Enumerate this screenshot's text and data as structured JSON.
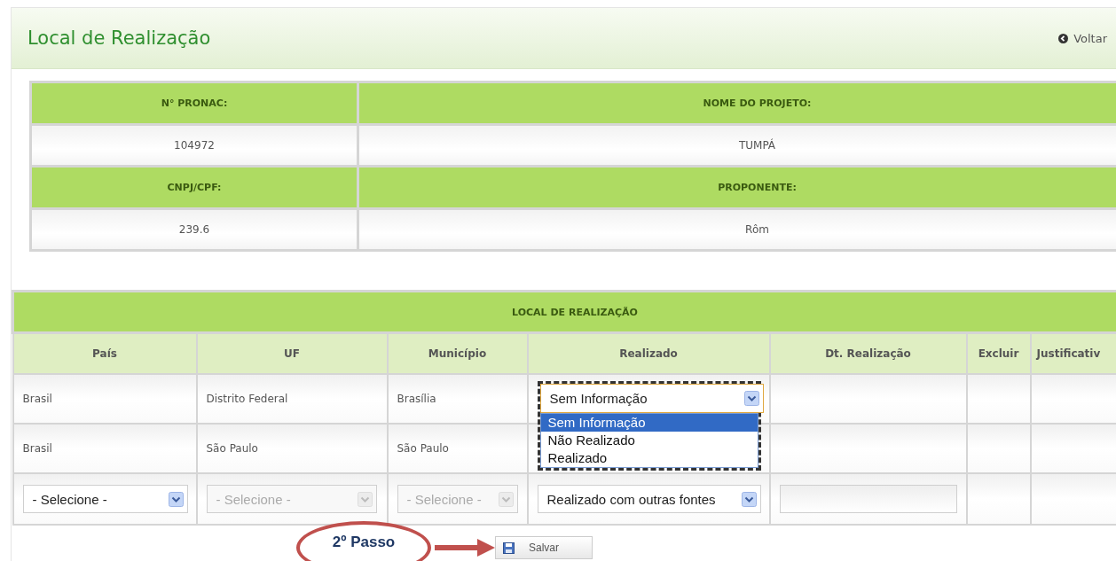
{
  "page": {
    "title": "Local de Realização",
    "back_link": "Voltar"
  },
  "project_info": [
    {
      "cells": [
        {
          "label": "N° PRONAC:",
          "value": "104972"
        },
        {
          "label": "NOME DO PROJETO:",
          "value": "TUMPÁ"
        }
      ]
    },
    {
      "cells": [
        {
          "label": "CNPJ/CPF:",
          "value": "239.6"
        },
        {
          "label": "PROPONENTE:",
          "value": "Rôm"
        }
      ]
    }
  ],
  "locations": {
    "title": "LOCAL DE REALIZAÇÃO",
    "columns": [
      "País",
      "UF",
      "Município",
      "Realizado",
      "Dt. Realização",
      "Excluir",
      "Justificativ"
    ],
    "rows": [
      {
        "pais": "Brasil",
        "uf": "Distrito Federal",
        "municipio": "Brasília",
        "realizado": {
          "value": "Sem Informação",
          "expanded": true,
          "options": [
            {
              "label": "Sem Informação",
              "selected": true
            },
            {
              "label": "Não Realizado",
              "selected": false
            },
            {
              "label": "Realizado",
              "selected": false
            }
          ]
        }
      },
      {
        "pais": "Brasil",
        "uf": "São Paulo",
        "municipio": "São Paulo"
      }
    ],
    "new_row": {
      "pais": {
        "value": "- Selecione -",
        "disabled": false
      },
      "uf": {
        "value": "- Selecione -",
        "disabled": true
      },
      "municipio": {
        "value": "- Selecione -",
        "disabled": true
      },
      "realizado": {
        "value": "Realizado com outras fontes",
        "disabled": false
      }
    }
  },
  "save_button": "Salvar",
  "annotation": {
    "label": "2º Passo"
  }
}
